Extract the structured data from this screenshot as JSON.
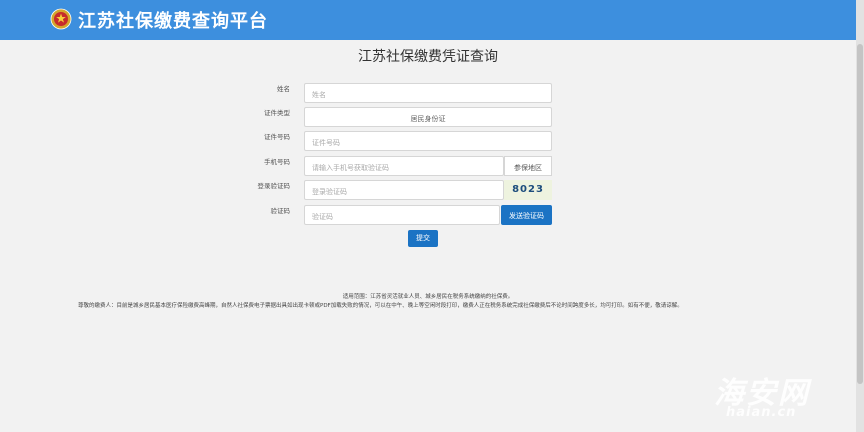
{
  "header": {
    "title": "江苏社保缴费查询平台",
    "emblem_icon": "national-emblem-icon",
    "bar_color": "#3d8fde"
  },
  "form": {
    "title": "江苏社保缴费凭证查询",
    "name": {
      "label": "姓名",
      "placeholder": "姓名"
    },
    "id_type": {
      "label": "证件类型",
      "value": "居民身份证"
    },
    "id_number": {
      "label": "证件号码",
      "placeholder": "证件号码"
    },
    "phone": {
      "label": "手机号码",
      "placeholder": "请输入手机号获取验证码",
      "region_label": "参保地区"
    },
    "login_code": {
      "label": "登录验证码",
      "placeholder": "登录验证码",
      "captcha": "8023"
    },
    "sms_code": {
      "label": "验证码",
      "placeholder": "验证码",
      "send_button": "发送验证码"
    },
    "submit_button": "提交",
    "button_color": "#1b73c4"
  },
  "footer": {
    "scope": "适用范围：江苏省灵活就业人员、城乡居民在税务系统缴纳的社保费。",
    "notice": "尊敬的缴费人：目前是城乡居民基本医疗保险缴费高峰期，自然人社保费电子票据出具如出现卡顿或PDF加载失败的情况，可以在中午、晚上等空闲时段打印，缴费人正在税务系统完成社保缴费后不论时间跨度多长，均可打印。如有不便，敬请谅解。"
  },
  "watermark": {
    "main": "海安网",
    "sub": "haian.cn"
  }
}
